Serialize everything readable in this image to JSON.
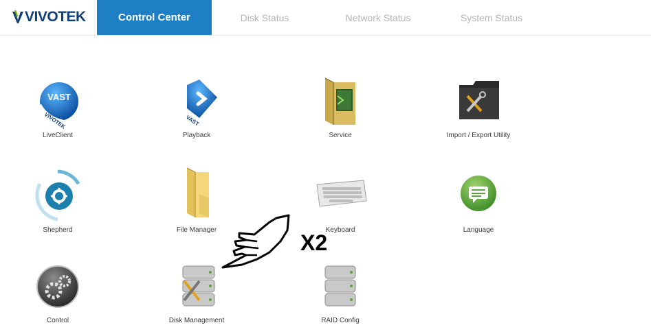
{
  "brand": {
    "name": "VIVOTEK"
  },
  "tabs": [
    {
      "label": "Control Center",
      "active": true
    },
    {
      "label": "Disk Status",
      "active": false
    },
    {
      "label": "Network Status",
      "active": false
    },
    {
      "label": "System Status",
      "active": false
    }
  ],
  "apps": [
    {
      "label": "LiveClient",
      "icon": "vast-liveclient-icon"
    },
    {
      "label": "Playback",
      "icon": "vast-playback-icon"
    },
    {
      "label": "Service",
      "icon": "service-folder-icon"
    },
    {
      "label": "Import / Export Utility",
      "icon": "tools-folder-icon"
    },
    {
      "label": "Shepherd",
      "icon": "shepherd-gear-icon"
    },
    {
      "label": "File Manager",
      "icon": "folder-icon"
    },
    {
      "label": "Keyboard",
      "icon": "keyboard-icon"
    },
    {
      "label": "Language",
      "icon": "speech-bubble-icon"
    },
    {
      "label": "Control",
      "icon": "control-gears-icon"
    },
    {
      "label": "Disk Management",
      "icon": "disk-tools-icon"
    },
    {
      "label": "RAID Config",
      "icon": "disk-stack-icon"
    }
  ],
  "annotation": {
    "click_count": "X2",
    "icon": "pointing-hand-icon"
  },
  "colors": {
    "accent": "#1e7fc5",
    "brand": "#0f3f78",
    "inactive_tab": "#b4b4b4"
  }
}
